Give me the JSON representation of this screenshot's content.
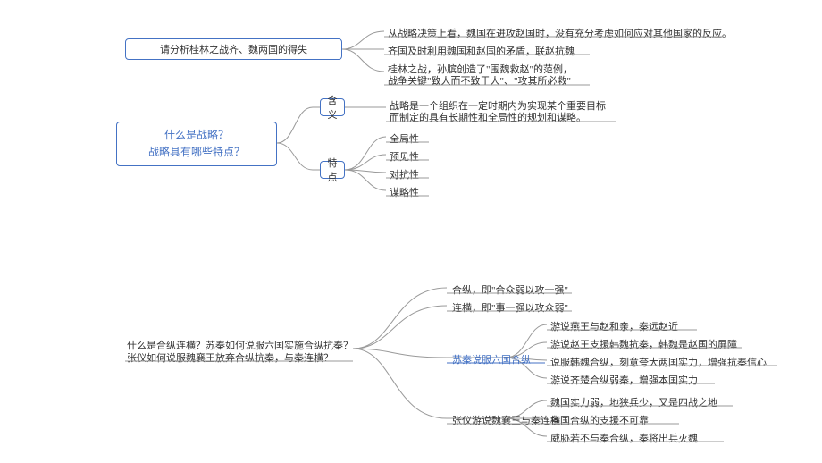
{
  "q1": {
    "prompt": "请分析桂林之战齐、魏两国的得失",
    "a1": "从战略决策上看，魏国在进攻赵国时，没有充分考虑如何应对其他国家的反应。",
    "a2": "齐国及时利用魏国和赵国的矛盾，联赵抗魏",
    "a3a": "桂林之战，孙膑创造了\"围魏救赵\"的范例，",
    "a3b": "战争关键\"致人而不致于人\"、\"攻其所必救\""
  },
  "main": {
    "line1": "什么是战略？",
    "line2": "战略具有哪些特点？"
  },
  "meaning": {
    "label": "含义",
    "text1": "战略是一个组织在一定时期内为实现某个重要目标",
    "text2": "而制定的具有长期性和全局性的规划和谋略。"
  },
  "feature": {
    "label": "特点",
    "items": [
      "全局性",
      "预见性",
      "对抗性",
      "谋略性"
    ]
  },
  "q2": {
    "line1": "什么是合纵连横？苏秦如何说服六国实施合纵抗秦？",
    "line2": "张仪如何说服魏襄王放弃合纵抗秦，与秦连横？"
  },
  "hz": "合纵，即\"合众弱以攻一强\"",
  "lh": "连横，即\"事一强以攻众弱\"",
  "su": {
    "label": "苏秦说服六国合纵",
    "a": "游说燕王与赵和亲，秦远赵近",
    "b": "游说赵王支援韩魏抗秦，韩魏是赵国的屏障",
    "c": "说服韩魏合纵，刻意夸大两国实力，增强抗秦信心",
    "d": "游说齐楚合纵弱秦，增强本国实力"
  },
  "zhang": {
    "label": "张仪游说魏襄王与秦连横",
    "a": "魏国实力弱，地狭兵少，又是四战之地",
    "b": "各国合纵的支援不可靠",
    "c": "威胁若不与秦合纵，秦将出兵灭魏"
  }
}
